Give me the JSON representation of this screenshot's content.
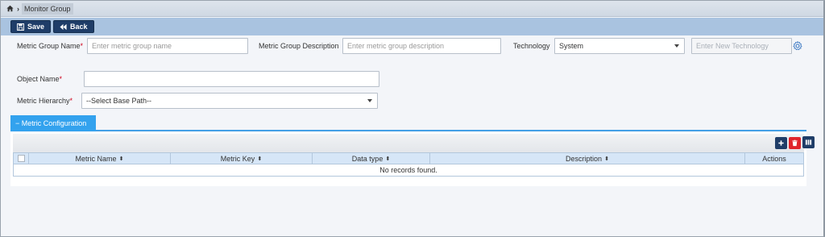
{
  "breadcrumb": {
    "current": "Monitor Group"
  },
  "toolbar": {
    "save_label": "Save",
    "back_label": "Back"
  },
  "form": {
    "group_name": {
      "label": "Metric Group Name",
      "required": "*",
      "placeholder": "Enter metric group name"
    },
    "group_description": {
      "label": "Metric Group Description",
      "placeholder": "Enter metric group description"
    },
    "technology": {
      "label": "Technology",
      "selected": "System",
      "new_placeholder": "Enter New Technology"
    },
    "object_name": {
      "label": "Object Name",
      "required": "*",
      "value": ""
    },
    "hierarchy": {
      "label": "Metric Hierarchy",
      "required": "*",
      "selected": "--Select Base Path--"
    }
  },
  "tab": {
    "label": "− Metric Configuration"
  },
  "grid": {
    "columns": [
      "Metric Name",
      "Metric Key",
      "Data type",
      "Description",
      "Actions"
    ],
    "sort_glyph": "⬍",
    "empty_message": "No records found.",
    "buttons": [
      "add-icon",
      "delete-icon",
      "columns-icon"
    ]
  },
  "colors": {
    "primary": "#1f3d68",
    "tab": "#33a2ee",
    "danger": "#e0242b",
    "header": "#d6e6f7"
  }
}
